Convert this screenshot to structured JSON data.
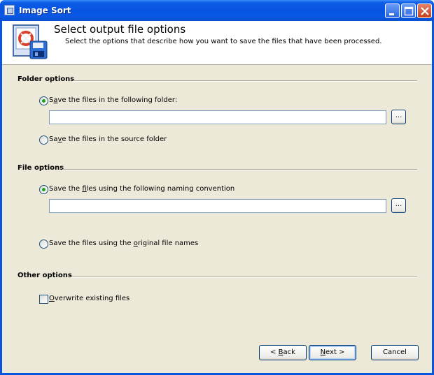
{
  "window": {
    "title": "Image Sort",
    "controls": {
      "minimize": "minimize",
      "maximize": "maximize",
      "close": "close"
    }
  },
  "header": {
    "title": "Select output file options",
    "subtitle": "Select the options that describe how you want to save the files that have been processed."
  },
  "folder_options": {
    "label": "Folder options",
    "opt1_pre": "S",
    "opt1_acc": "a",
    "opt1_post": "ve the files in the following folder:",
    "opt1_selected": true,
    "folder_value": "",
    "browse_label": "...",
    "opt2_pre": "Sa",
    "opt2_acc": "v",
    "opt2_post": "e the files in the source folder",
    "opt2_selected": false
  },
  "file_options": {
    "label": "File options",
    "opt1_pre": "Save the ",
    "opt1_acc": "f",
    "opt1_post": "iles using the following naming convention",
    "opt1_selected": true,
    "naming_value": "",
    "browse_label": "...",
    "opt2_pre": "Save the files using the ",
    "opt2_acc": "o",
    "opt2_post": "riginal file names",
    "opt2_selected": false
  },
  "other_options": {
    "label": "Other options",
    "overwrite_acc": "O",
    "overwrite_post": "verwrite existing files",
    "overwrite_checked": false
  },
  "buttons": {
    "back_pre": "< ",
    "back_acc": "B",
    "back_post": "ack",
    "next_acc": "N",
    "next_post": "ext >",
    "cancel": "Cancel"
  },
  "colors": {
    "titlebar": "#0a55dd",
    "dialog_bg": "#ece9d8",
    "radio_dot": "#21a121"
  }
}
